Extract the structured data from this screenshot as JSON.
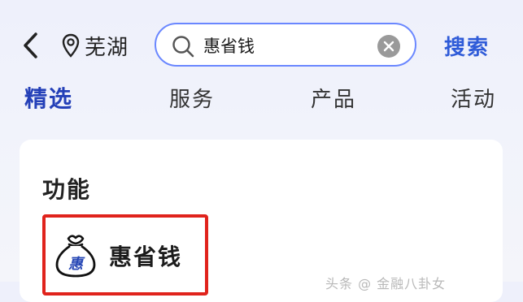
{
  "header": {
    "back_icon": "chevron-left-icon",
    "location": {
      "icon": "location-pin-icon",
      "label": "芜湖"
    },
    "search": {
      "icon": "search-icon",
      "value": "惠省钱",
      "clear_icon": "clear-icon"
    },
    "search_button_label": "搜索"
  },
  "tabs": [
    {
      "label": "精选",
      "active": true
    },
    {
      "label": "服务",
      "active": false
    },
    {
      "label": "产品",
      "active": false
    },
    {
      "label": "活动",
      "active": false
    }
  ],
  "section": {
    "title": "功能",
    "items": [
      {
        "label": "惠省钱",
        "icon": "money-bag-icon",
        "icon_glyph": "惠",
        "highlighted": true
      }
    ]
  },
  "watermark": "头条 @ 金融八卦女",
  "colors": {
    "accent": "#2f5bd8",
    "active_tab": "#2440b8",
    "search_border": "#6a87ff",
    "highlight": "#e0231c"
  }
}
